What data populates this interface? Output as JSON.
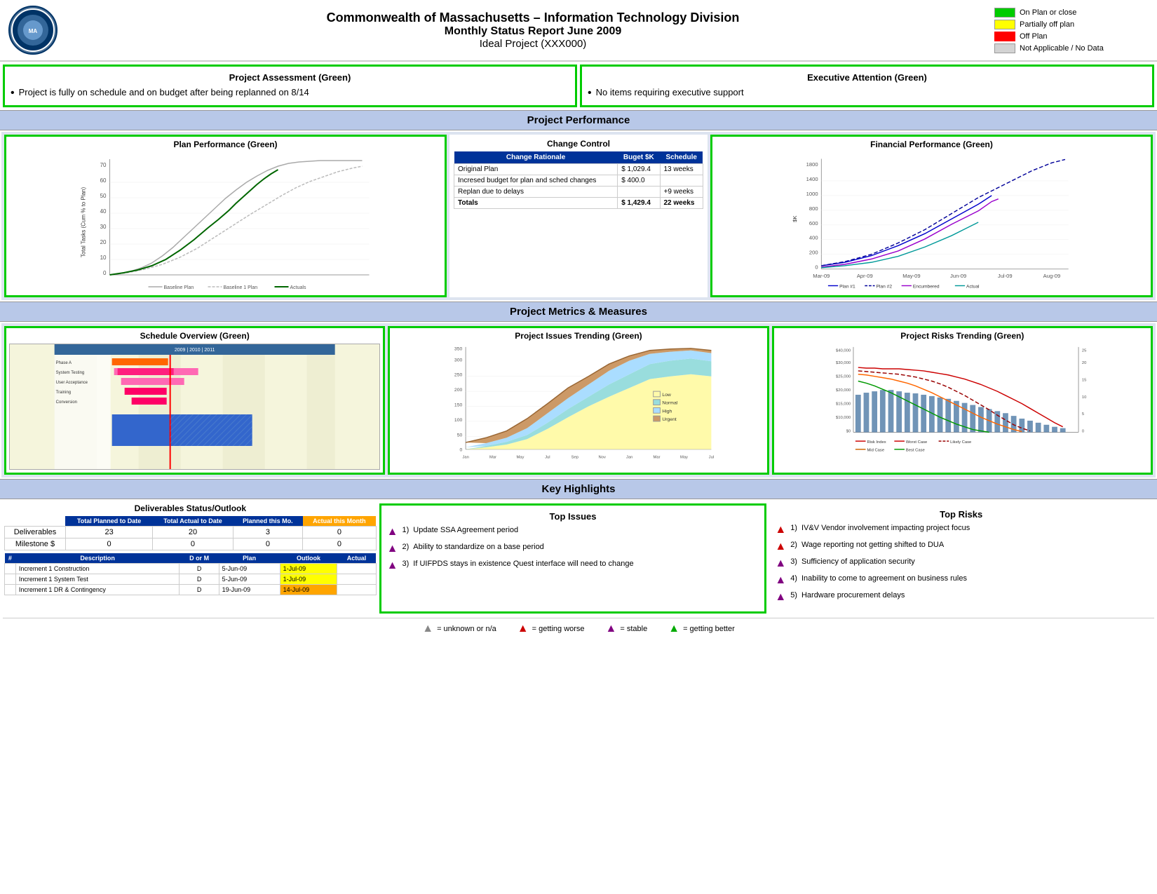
{
  "header": {
    "title_line1": "Commonwealth of Massachusetts – Information Technology Division",
    "title_line2": "Monthly Status Report June 2009",
    "title_line3": "Ideal Project (XXX000)"
  },
  "legend": {
    "items": [
      {
        "label": "On Plan or close",
        "color": "green"
      },
      {
        "label": "Partially off plan",
        "color": "yellow"
      },
      {
        "label": "Off Plan",
        "color": "red"
      },
      {
        "label": "Not Applicable / No Data",
        "color": "gray"
      }
    ]
  },
  "project_assessment": {
    "title": "Project Assessment (Green)",
    "bullet": "Project is fully on schedule and on budget after being replanned on 8/14"
  },
  "executive_attention": {
    "title": "Executive Attention (Green)",
    "bullet": "No items requiring executive support"
  },
  "project_performance": {
    "section_title": "Project Performance",
    "plan_performance": {
      "title": "Plan Performance (Green)"
    },
    "change_control": {
      "title": "Change Control",
      "headers": [
        "Change Rationale",
        "Buget $K",
        "Schedule"
      ],
      "rows": [
        {
          "rationale": "Original Plan",
          "budget": "$ 1,029.4",
          "schedule": "13 weeks"
        },
        {
          "rationale": "Incresed budget for plan and sched changes",
          "budget": "$   400.0",
          "schedule": ""
        },
        {
          "rationale": "Replan due to delays",
          "budget": "",
          "schedule": "+9 weeks"
        },
        {
          "rationale": "Totals",
          "budget": "$ 1,429.4",
          "schedule": "22 weeks"
        }
      ]
    },
    "financial_performance": {
      "title": "Financial Performance (Green)",
      "legend": [
        "Plan #1",
        "Plan #2",
        "Encumbered",
        "Actual"
      ]
    }
  },
  "project_metrics": {
    "section_title": "Project Metrics & Measures",
    "schedule_overview": {
      "title": "Schedule Overview (Green)"
    },
    "issues_trending": {
      "title": "Project Issues Trending (Green)",
      "legend": [
        "Low",
        "Normal",
        "High",
        "Urgent"
      ]
    },
    "risks_trending": {
      "title": "Project Risks Trending (Green)",
      "legend": [
        "Risk Index",
        "Worst Case",
        "Likely Case",
        "Mid Case",
        "Best Case"
      ]
    }
  },
  "key_highlights": {
    "section_title": "Key Highlights",
    "top_issues": {
      "title": "Top Issues",
      "items": [
        {
          "num": "1)",
          "text": "Update SSA Agreement period",
          "arrow": "purple"
        },
        {
          "num": "2)",
          "text": "Ability to standardize on a base period",
          "arrow": "purple"
        },
        {
          "num": "3)",
          "text": "If UIFPDS stays in existence Quest interface will need to change",
          "arrow": "purple"
        }
      ]
    },
    "top_risks": {
      "title": "Top Risks",
      "items": [
        {
          "num": "1)",
          "text": "IV&V Vendor involvement impacting project focus",
          "arrow": "red"
        },
        {
          "num": "2)",
          "text": "Wage reporting not getting shifted to DUA",
          "arrow": "red"
        },
        {
          "num": "3)",
          "text": "Sufficiency of application security",
          "arrow": "purple"
        },
        {
          "num": "4)",
          "text": "Inability to come to agreement on business rules",
          "arrow": "purple"
        },
        {
          "num": "5)",
          "text": "Hardware procurement delays",
          "arrow": "purple"
        }
      ]
    }
  },
  "deliverables": {
    "title": "Deliverables Status/Outlook",
    "summary_headers": [
      "Total Planned to Date",
      "Total Actual to Date",
      "Planned this Mo.",
      "Actual this Month"
    ],
    "summary_rows": [
      {
        "label": "Deliverables",
        "planned": "23",
        "actual": "20",
        "planned_mo": "3",
        "actual_mo": "0"
      },
      {
        "label": "Milestone $",
        "planned": "0",
        "actual": "0",
        "planned_mo": "0",
        "actual_mo": "0"
      }
    ],
    "detail_headers": [
      "#",
      "Description",
      "D or M",
      "Plan",
      "Outlook",
      "Actual"
    ],
    "detail_rows": [
      {
        "num": "",
        "desc": "Increment 1 Construction",
        "dom": "D",
        "plan": "5-Jun-09",
        "outlook": "1-Jul-09",
        "actual": "",
        "outlook_color": "yellow"
      },
      {
        "num": "",
        "desc": "Increment 1 System Test",
        "dom": "D",
        "plan": "5-Jun-09",
        "outlook": "1-Jul-09",
        "actual": "",
        "outlook_color": "yellow"
      },
      {
        "num": "",
        "desc": "Increment 1 DR & Contingency",
        "dom": "D",
        "plan": "19-Jun-09",
        "outlook": "14-Jul-09",
        "actual": "",
        "outlook_color": "orange"
      }
    ]
  },
  "bottom_legend": {
    "items": [
      {
        "symbol": "▲",
        "color": "gray",
        "label": "= unknown or n/a"
      },
      {
        "symbol": "▲",
        "color": "red",
        "label": "= getting worse"
      },
      {
        "symbol": "▲",
        "color": "purple",
        "label": "= stable"
      },
      {
        "symbol": "▲",
        "color": "green",
        "label": "= getting better"
      }
    ]
  }
}
